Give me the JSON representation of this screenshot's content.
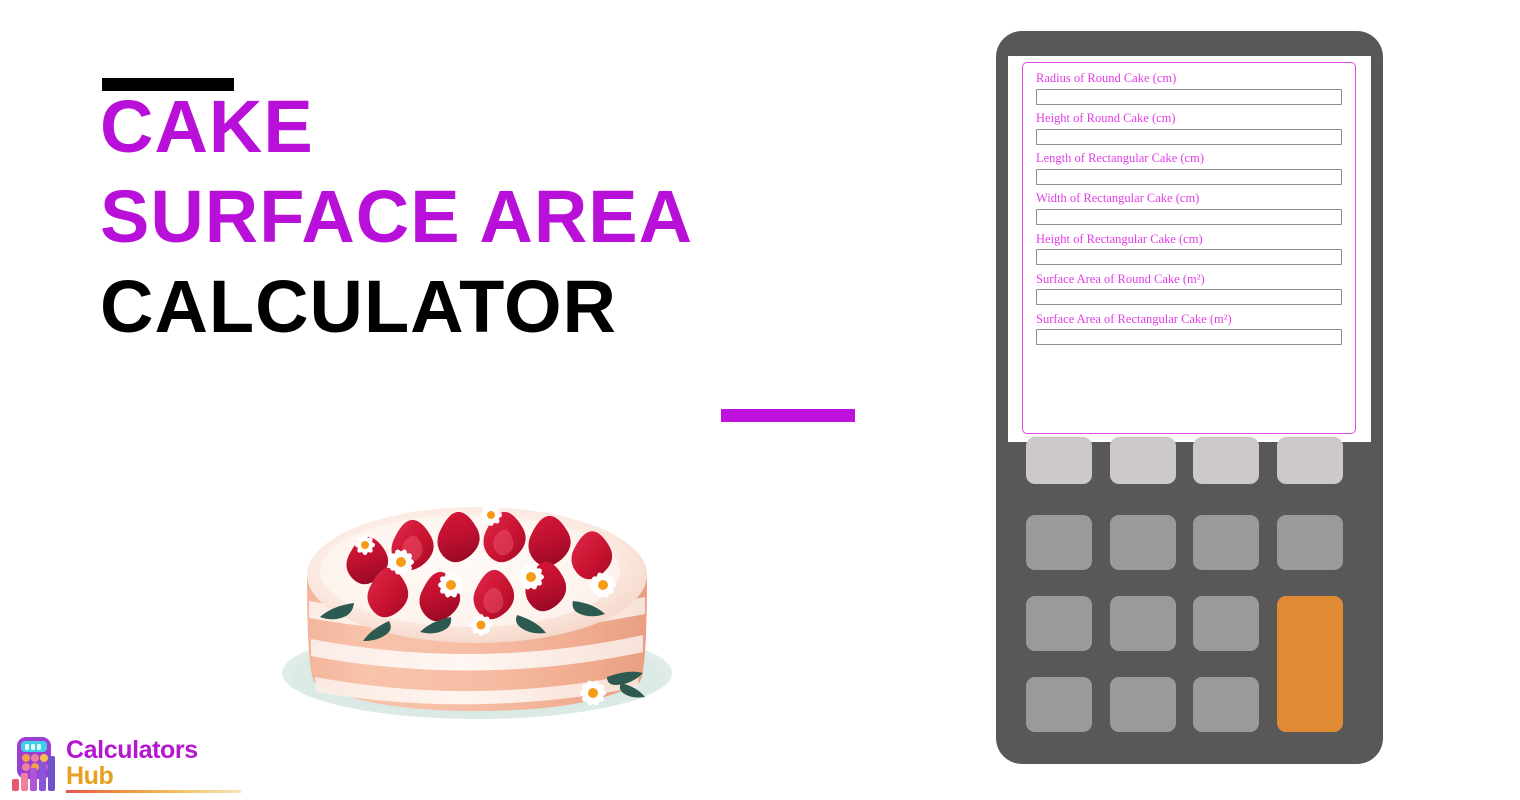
{
  "title": {
    "line1": "CAKE",
    "line2": "SURFACE AREA",
    "line3": "CALCULATOR",
    "accent_color": "#b810d8",
    "dark_color": "#000000"
  },
  "logo": {
    "line1": "Calculators",
    "line2": "Hub",
    "line1_color": "#b516cf",
    "line2_color": "#e8a020",
    "icon": "calculator-bar-chart-icon"
  },
  "illustration": {
    "name": "strawberry-cake-illustration",
    "description": "Layered pink cake topped with strawberries and daisies on a pale teal plate",
    "colors": {
      "plate": "#d9e8e4",
      "cake_layer": "#f2b297",
      "frosting": "#fdf0ea",
      "strawberry": "#cf1232",
      "strawberry_dark": "#9e0b28",
      "leaf": "#2d5a50",
      "flower_center": "#f59b16"
    }
  },
  "calculator": {
    "body_color": "#585858",
    "screen_border_color": "#e24ae8",
    "label_color": "#e33ce8",
    "fields": [
      {
        "label": "Radius of Round Cake (cm)",
        "value": "",
        "name": "radius-round-cake"
      },
      {
        "label": "Height of Round Cake (cm)",
        "value": "",
        "name": "height-round-cake"
      },
      {
        "label": "Length of Rectangular Cake (cm)",
        "value": "",
        "name": "length-rect-cake"
      },
      {
        "label": "Width of Rectangular Cake (cm)",
        "value": "",
        "name": "width-rect-cake"
      },
      {
        "label": "Height of Rectangular Cake (cm)",
        "value": "",
        "name": "height-rect-cake"
      },
      {
        "label": "Surface Area of Round Cake (m²)",
        "value": "",
        "name": "surface-area-round-cake"
      },
      {
        "label": "Surface Area of Rectangular Cake (m²)",
        "value": "",
        "name": "surface-area-rect-cake"
      }
    ],
    "keys": {
      "row_top_color": "#ccc9c8",
      "key_color": "#9a9a9a",
      "accent_key_color": "#e08a34",
      "labels": [
        "",
        "",
        "",
        "",
        "",
        "",
        "",
        "",
        "",
        "",
        "",
        "",
        "",
        "",
        "",
        ""
      ]
    }
  }
}
